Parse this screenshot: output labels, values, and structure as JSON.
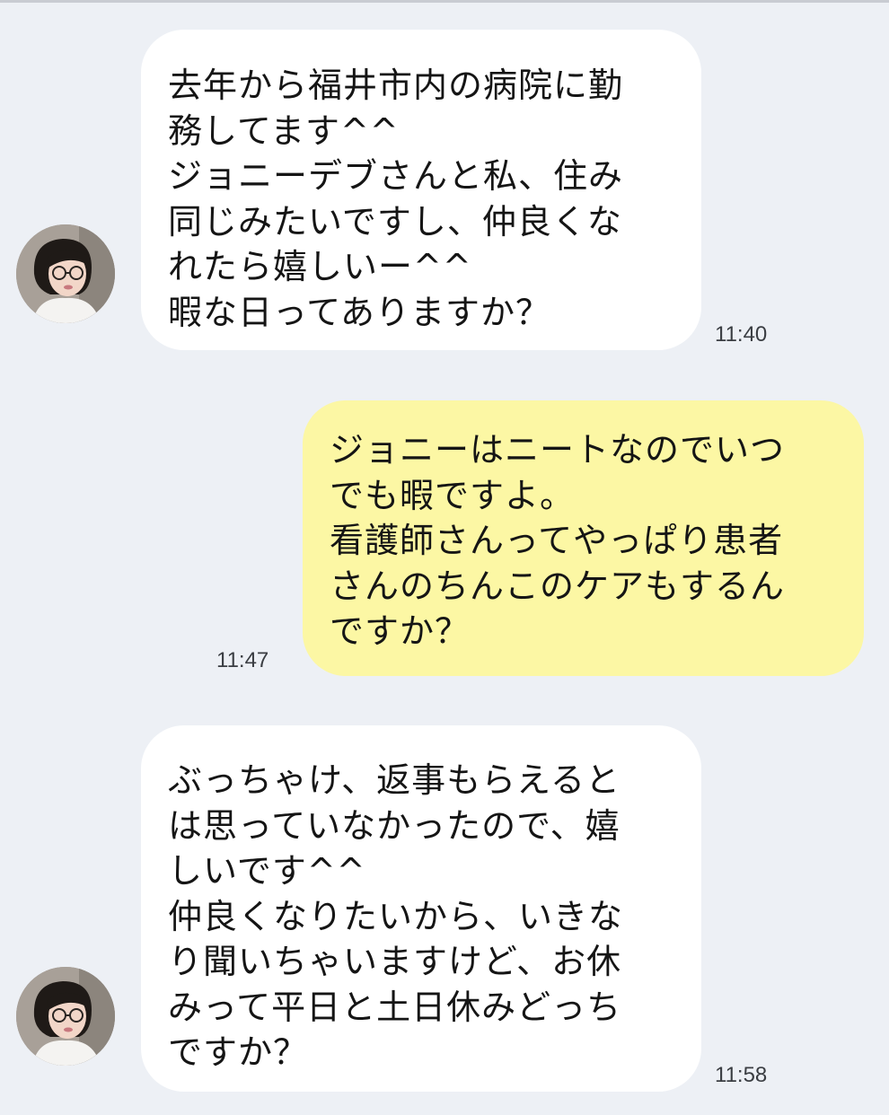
{
  "chat": {
    "messages": [
      {
        "sender": "other",
        "lines": [
          "去年から福井市内の病院に勤",
          "務してます^^",
          "ジョニーデブさんと私、住み",
          "同じみたいですし、仲良くな",
          "れたら嬉しいー^^",
          "暇な日ってありますか？"
        ],
        "time": "11:40"
      },
      {
        "sender": "me",
        "lines": [
          "ジョニーはニートなのでいつ",
          "でも暇ですよ。",
          "看護師さんってやっぱり患者",
          "さんのちんこのケアもするん",
          "ですか？"
        ],
        "time": "11:47"
      },
      {
        "sender": "other",
        "lines": [
          "ぶっちゃけ、返事もらえると",
          "は思っていなかったので、嬉",
          "しいです^^",
          "仲良くなりたいから、いきな",
          "り聞いちゃいますけど、お休",
          "みって平日と土日休みどっち",
          "ですか？"
        ],
        "time": "11:58"
      }
    ]
  },
  "colors": {
    "background": "#edf0f5",
    "incoming_bubble": "#ffffff",
    "outgoing_bubble": "#fcf7a4"
  },
  "icons": {
    "avatar": "profile-photo-woman-glasses"
  }
}
